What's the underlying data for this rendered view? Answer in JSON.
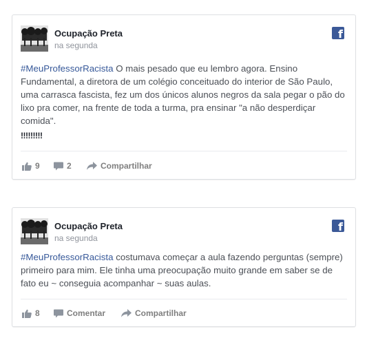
{
  "posts": [
    {
      "page_name": "Ocupação Preta",
      "time": "na segunda",
      "hashtag": "#MeuProfessorRacista",
      "text": " O mais pesado que eu lembro agora. Ensino Fundamental, a diretora de um colégio conceituado do interior de São Paulo, uma carrasca fascista, fez um dos únicos alunos negros da sala pegar o pão do lixo pra comer, na frente de toda a turma, pra ensinar \"a não desperdiçar comida\".",
      "extra": "!!!!!!!!!",
      "likes": "9",
      "comments": "2",
      "share_label": "Compartilhar",
      "icons": [
        "thumbs-up-icon",
        "comment-icon",
        "share-icon"
      ]
    },
    {
      "page_name": "Ocupação Preta",
      "time": "na segunda",
      "hashtag": "#MeuProfessorRacista",
      "text": " costumava começar a aula fazendo perguntas (sempre) primeiro para mim. Ele tinha uma preocupação muito grande em saber se de fato eu ~ conseguia acompanhar ~ suas aulas.",
      "likes": "8",
      "comment_label": "Comentar",
      "share_label": "Compartilhar",
      "icons": [
        "thumbs-up-icon",
        "comment-icon",
        "share-icon"
      ]
    }
  ],
  "brand": {
    "facebook_icon": "facebook-icon",
    "facebook_color": "#3b5998",
    "hashtag_color": "#365899"
  }
}
